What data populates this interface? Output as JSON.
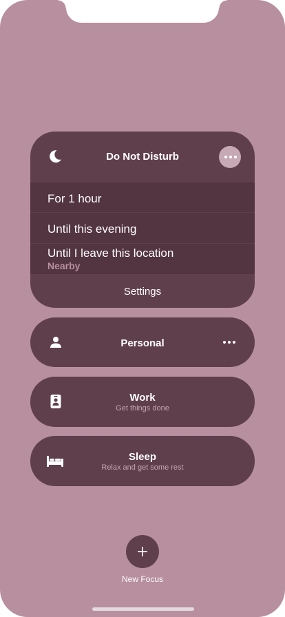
{
  "dnd": {
    "title": "Do Not Disturb",
    "icon": "moon-icon",
    "options": [
      {
        "label": "For 1 hour"
      },
      {
        "label": "Until this evening"
      },
      {
        "label": "Until I leave this location",
        "sublabel": "Nearby"
      }
    ],
    "settings_label": "Settings"
  },
  "focus_modes": [
    {
      "title": "Personal",
      "subtitle": "",
      "icon": "person-icon"
    },
    {
      "title": "Work",
      "subtitle": "Get things done",
      "icon": "id-badge-icon"
    },
    {
      "title": "Sleep",
      "subtitle": "Relax and get some rest",
      "icon": "bed-icon"
    }
  ],
  "new_focus": {
    "label": "New Focus",
    "icon": "plus-icon"
  },
  "colors": {
    "background": "#b78f9f",
    "card": "#603f4c",
    "card_selected": "#533441",
    "accent_text": "#b78f9f"
  }
}
